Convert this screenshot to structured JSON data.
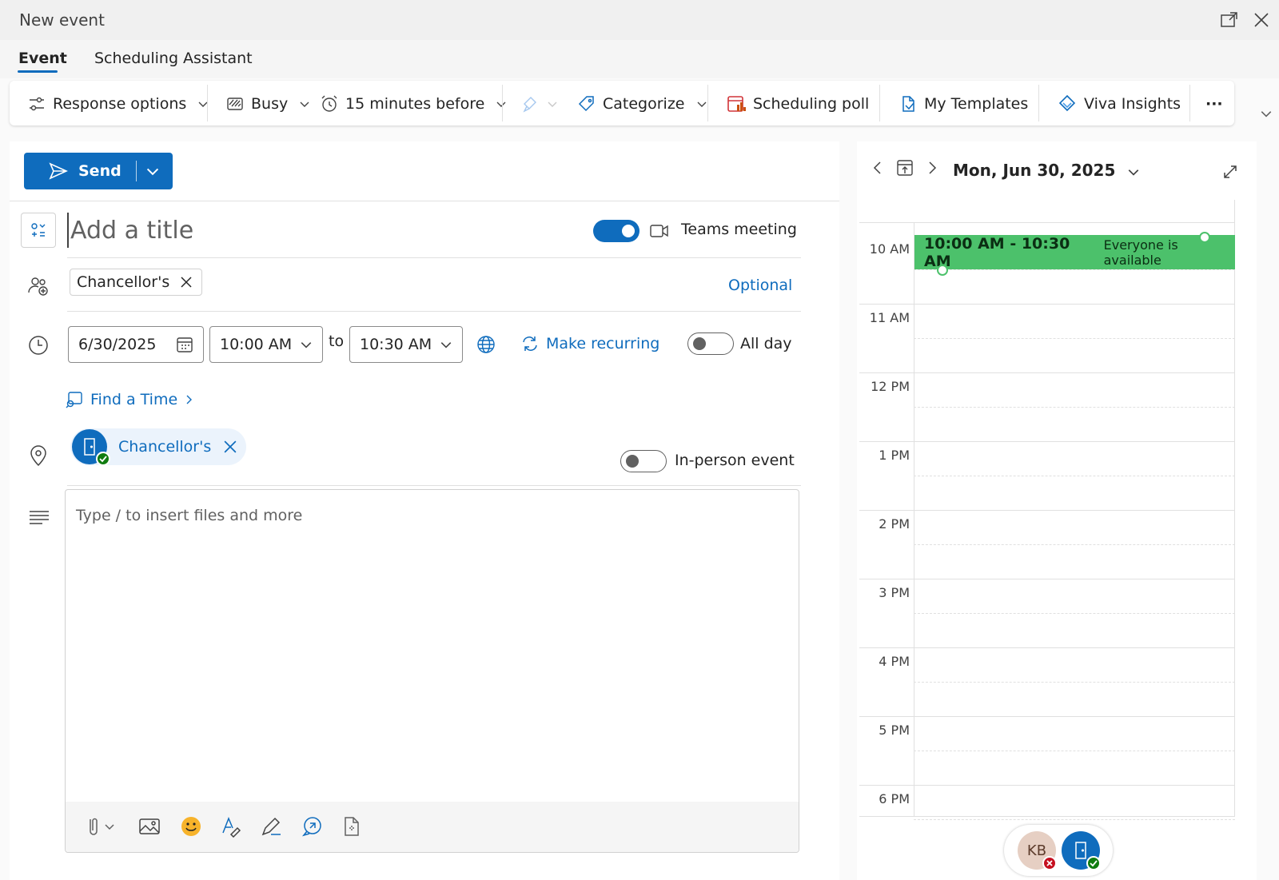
{
  "window": {
    "title": "New event"
  },
  "tabs": [
    {
      "label": "Event"
    },
    {
      "label": "Scheduling Assistant"
    }
  ],
  "ribbon": {
    "response_options": "Response options",
    "show_as": "Busy",
    "reminder": "15 minutes before",
    "categorize": "Categorize",
    "scheduling_poll": "Scheduling poll",
    "my_templates": "My Templates",
    "viva_insights": "Viva Insights",
    "more": "···"
  },
  "send": {
    "label": "Send"
  },
  "event": {
    "title_placeholder": "Add a title",
    "teams_toggle_on": true,
    "teams_label": "Teams meeting",
    "attendee_chip": "Chancellor's",
    "optional_link": "Optional",
    "start_date": "6/30/2025",
    "start_time": "10:00 AM",
    "to_label": "to",
    "end_time": "10:30 AM",
    "make_recurring": "Make recurring",
    "all_day_label": "All day",
    "all_day_on": false,
    "find_time": "Find a Time",
    "location_chip": "Chancellor's",
    "in_person_label": "In-person event",
    "in_person_on": false,
    "body_placeholder": "Type / to insert files and more"
  },
  "calendar": {
    "date_label": "Mon, Jun 30, 2025",
    "hours": [
      "10 AM",
      "11 AM",
      "12 PM",
      "1 PM",
      "2 PM",
      "3 PM",
      "4 PM",
      "5 PM",
      "6 PM"
    ],
    "event_time": "10:00 AM - 10:30 AM",
    "event_status": "Everyone is available",
    "attendees": [
      {
        "initials": "KB",
        "status": "declined"
      },
      {
        "initials": "",
        "status": "accepted"
      }
    ]
  },
  "colors": {
    "accent": "#0f6cbd",
    "event_available": "#4cc16b",
    "accepted": "#107c10",
    "declined": "#c50f1f"
  }
}
